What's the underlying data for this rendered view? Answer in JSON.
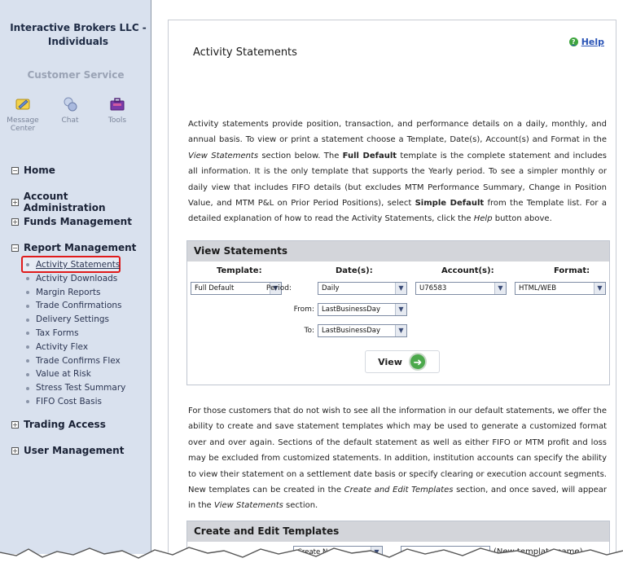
{
  "sidebar": {
    "firm_name": "Interactive Brokers LLC - Individuals",
    "customer_service": "Customer Service",
    "tools": [
      {
        "label": "Message Center",
        "icon": "message-center-icon"
      },
      {
        "label": "Chat",
        "icon": "chat-icon"
      },
      {
        "label": "Tools",
        "icon": "tools-icon"
      }
    ],
    "nav": {
      "home": "Home",
      "account_admin": "Account Administration",
      "funds": "Funds Management",
      "report": "Report Management",
      "report_items": [
        "Activity Statements",
        "Activity Downloads",
        "Margin Reports",
        "Trade Confirmations",
        "Delivery Settings",
        "Tax Forms",
        "Activity Flex",
        "Trade Confirms Flex",
        "Value at Risk",
        "Stress Test Summary",
        "FIFO Cost Basis"
      ],
      "trading": "Trading Access",
      "user": "User Management"
    }
  },
  "main": {
    "help": "Help",
    "title": "Activity Statements",
    "intro": {
      "p1": "Activity statements provide position, transaction, and performance details on a daily, monthly, and annual basis. To view or print a statement choose a Template, Date(s), Account(s) and Format in the ",
      "p1_italic": "View Statements",
      "p2": " section below. The ",
      "p2_bold": "Full Default",
      "p3": " template is the complete statement and includes all information. It is the only template that supports the Yearly period. To see a simpler monthly or daily view that includes FIFO details (but excludes MTM Performance Summary, Change in Position Value, and MTM P&L on Prior Period Positions), select ",
      "p3_bold": "Simple Default",
      "p4": " from the Template list. For a detailed explanation of how to read the Activity Statements, click the ",
      "p4_italic": "Help",
      "p5": " button above."
    },
    "view": {
      "heading": "View Statements",
      "template_h": "Template:",
      "dates_h": "Date(s):",
      "accounts_h": "Account(s):",
      "format_h": "Format:",
      "template_val": "Full Default",
      "period_label": "Period:",
      "period_val": "Daily",
      "from_label": "From:",
      "from_val": "LastBusinessDay",
      "to_label": "To:",
      "to_val": "LastBusinessDay",
      "account_val": "U76583",
      "format_val": "HTML/WEB",
      "view_btn": "View"
    },
    "custom": {
      "p1": "For those customers that do not wish to see all the information in our default statements, we offer the ability to create and save statement templates which may be used to generate a customized format over and over again. Sections of the default statement as well as either FIFO or MTM profit and loss may be excluded from customized statements. In addition, institution accounts can specify the ability to view their statement on a settlement date basis or specify clearing or execution account segments. New templates can be created in the ",
      "p1_italic": "Create and Edit Templates",
      "p2": " section, and once saved, will appear in the ",
      "p2_italic": "View Statements",
      "p3": " section."
    },
    "create": {
      "heading": "Create and Edit Templates",
      "select_val": "Create New",
      "name_note": "(New template name)"
    }
  }
}
